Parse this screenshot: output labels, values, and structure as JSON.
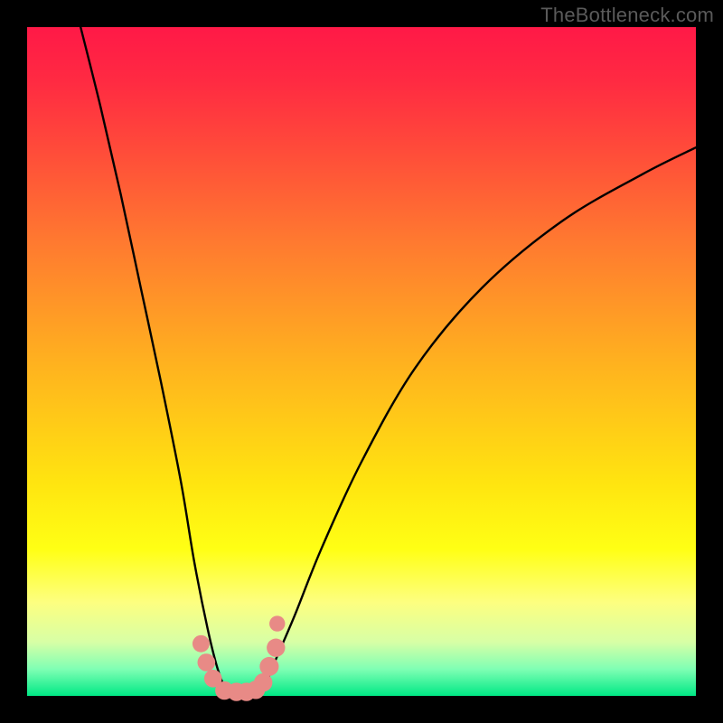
{
  "watermark": "TheBottleneck.com",
  "colors": {
    "page_bg": "#000000",
    "curve_stroke": "#000000",
    "marker_fill": "#e88a86",
    "marker_stroke": "#d46f6b"
  },
  "chart_data": {
    "type": "line",
    "title": "",
    "xlabel": "",
    "ylabel": "",
    "xlim": [
      0,
      100
    ],
    "ylim": [
      0,
      100
    ],
    "grid": false,
    "legend": false,
    "notes": "V-shaped bottleneck curve. y ≈ 0 at x ≈ 28–35; chart has no numeric axis labels so values are estimated from pixel position on a 0–100 normalized scale.",
    "series": [
      {
        "name": "left-branch",
        "x": [
          8,
          11,
          14,
          17,
          20,
          23,
          25,
          27,
          28.5,
          30
        ],
        "y": [
          100,
          88,
          75,
          61,
          47,
          32,
          20,
          10,
          4,
          0
        ]
      },
      {
        "name": "right-branch",
        "x": [
          35,
          37,
          40,
          44,
          50,
          58,
          68,
          80,
          92,
          100
        ],
        "y": [
          0,
          5,
          12,
          22,
          35,
          49,
          61,
          71,
          78,
          82
        ]
      }
    ],
    "markers": {
      "name": "highlight-points",
      "x": [
        26.0,
        26.8,
        27.8,
        29.5,
        31.3,
        32.8,
        34.2,
        35.3,
        36.2,
        37.2,
        37.4
      ],
      "y": [
        7.8,
        5.0,
        2.6,
        0.8,
        0.6,
        0.6,
        0.9,
        2.0,
        4.4,
        7.2,
        10.8
      ],
      "r": [
        1.2,
        1.3,
        1.3,
        1.4,
        1.4,
        1.4,
        1.4,
        1.4,
        1.5,
        1.4,
        1.0
      ]
    }
  }
}
